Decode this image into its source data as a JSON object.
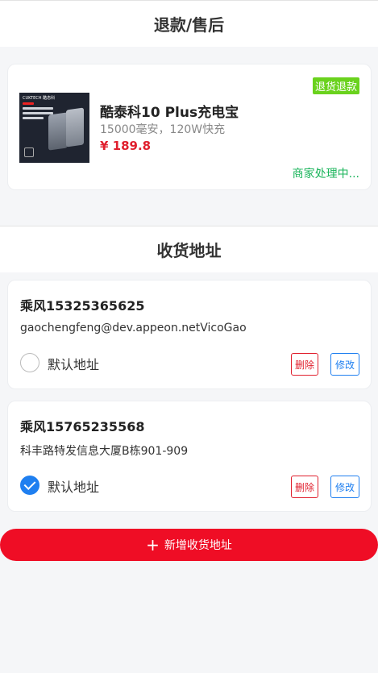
{
  "refund_header": {
    "title": "退款/售后"
  },
  "refund_card": {
    "product_title": "酷泰科10 Plus充电宝",
    "product_subtitle": "15000毫安，120W快充",
    "price": "¥ 189.8",
    "badge": "退货退款",
    "status": "商家处理中...",
    "thumb_brand": "CUKTECH 酷态科"
  },
  "address_header": {
    "title": "收货地址"
  },
  "addresses": [
    {
      "name": "乘风15325365625",
      "detail": "gaochengfeng@dev.appeon.netVicoGao",
      "default_label": "默认地址",
      "checked": false,
      "delete_label": "删除",
      "edit_label": "修改"
    },
    {
      "name": "乘风15765235568",
      "detail": "科丰路特发信息大厦B栋901-909",
      "default_label": "默认地址",
      "checked": true,
      "delete_label": "删除",
      "edit_label": "修改"
    }
  ],
  "add_button": {
    "icon": "plus-icon",
    "label": "新增收货地址"
  },
  "colors": {
    "accent_red": "#ef0d25",
    "accent_blue": "#1f7ff0",
    "status_green": "#19b45a",
    "badge_green": "#6ad21d"
  }
}
